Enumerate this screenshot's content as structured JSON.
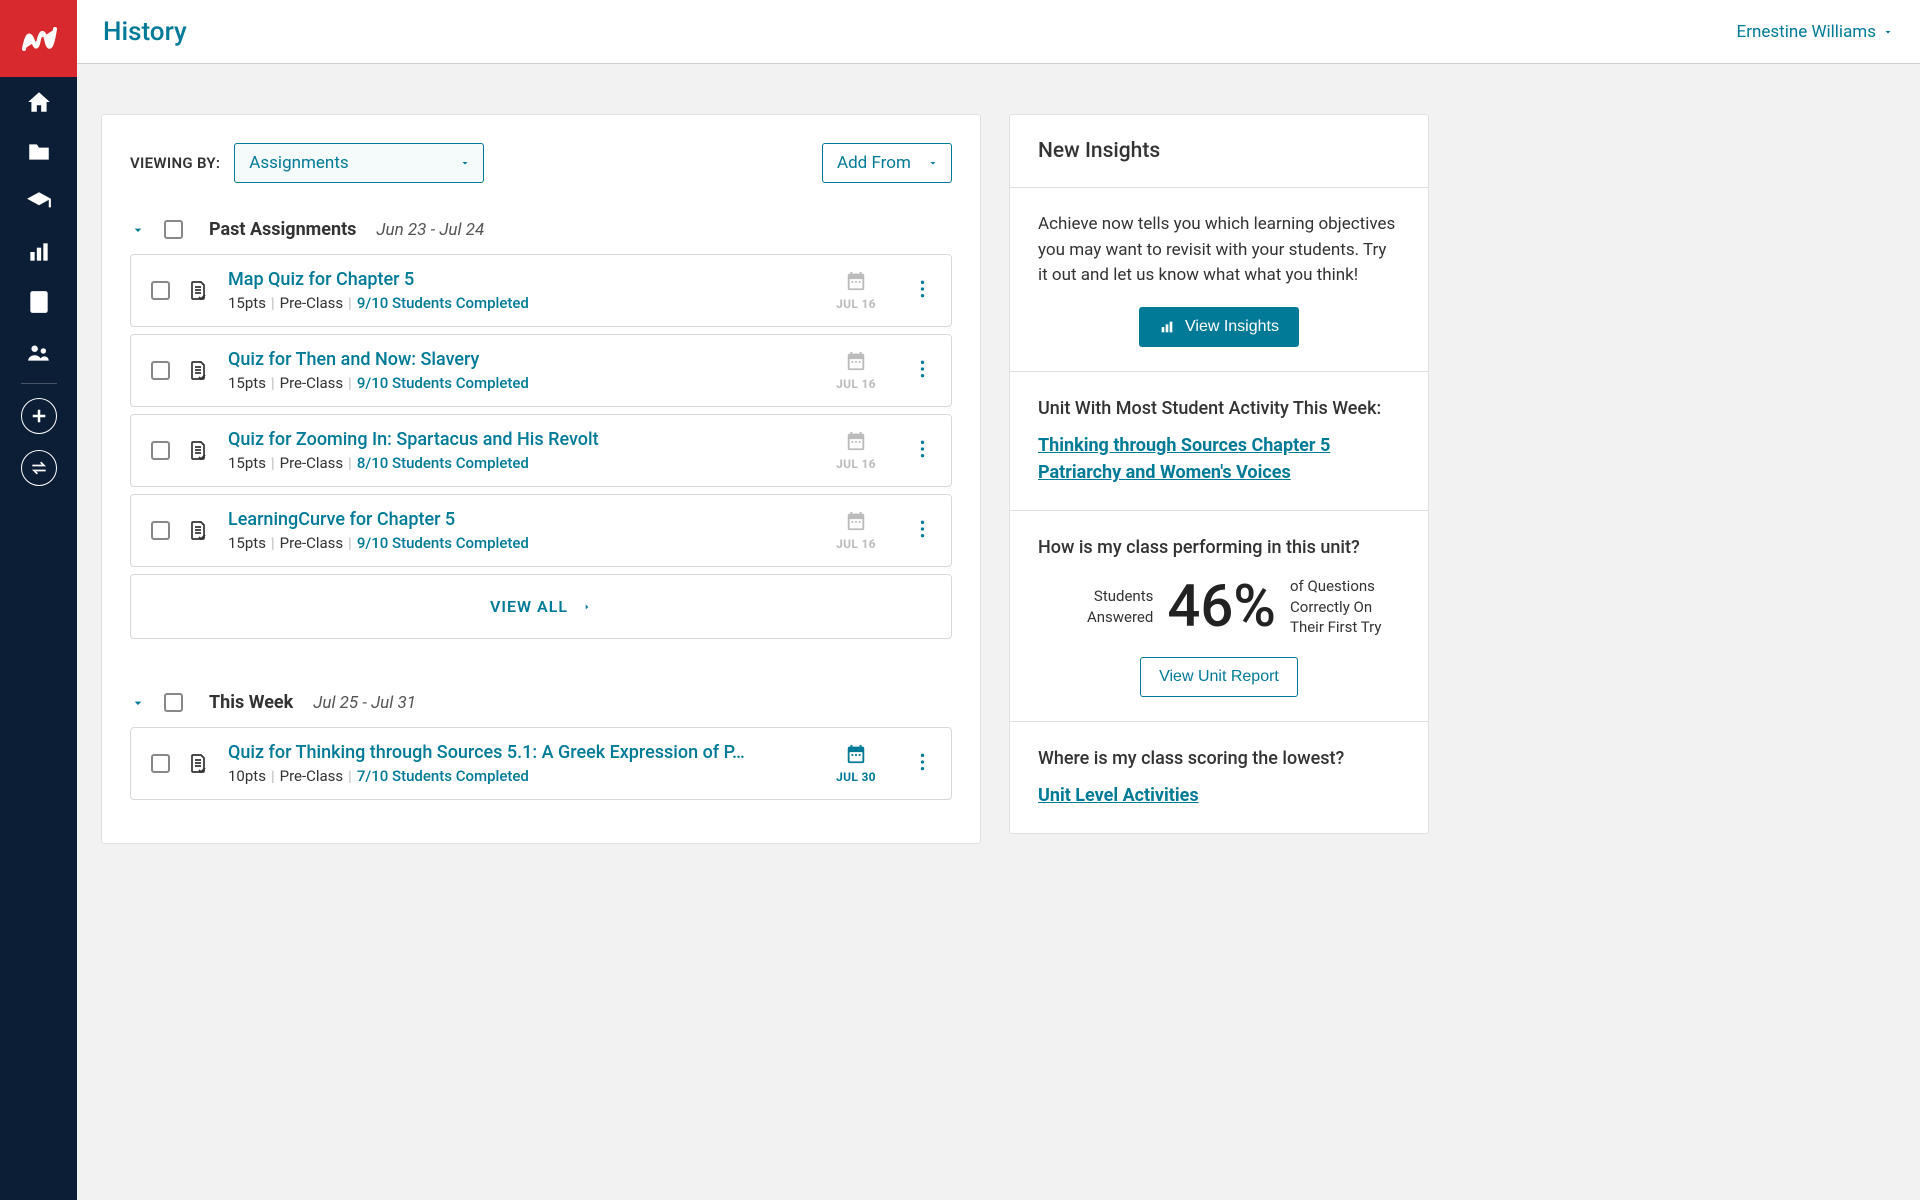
{
  "header": {
    "title": "History",
    "user": "Ernestine Williams"
  },
  "toolbar": {
    "viewing_by_label": "VIEWING BY:",
    "viewing_by_value": "Assignments",
    "add_from_label": "Add From"
  },
  "sections": {
    "past": {
      "title": "Past Assignments",
      "range": "Jun 23 - Jul 24",
      "items": [
        {
          "title": "Map Quiz for Chapter 5",
          "points": "15pts",
          "tag": "Pre-Class",
          "completed": "9/10 Students Completed",
          "due": "JUL 16",
          "accent": false
        },
        {
          "title": "Quiz for Then and Now: Slavery",
          "points": "15pts",
          "tag": "Pre-Class",
          "completed": "9/10 Students Completed",
          "due": "JUL 16",
          "accent": false
        },
        {
          "title": "Quiz for Zooming In: Spartacus and His Revolt",
          "points": "15pts",
          "tag": "Pre-Class",
          "completed": "8/10 Students Completed",
          "due": "JUL 16",
          "accent": false
        },
        {
          "title": "LearningCurve for Chapter 5",
          "points": "15pts",
          "tag": "Pre-Class",
          "completed": "9/10 Students Completed",
          "due": "JUL 16",
          "accent": false
        }
      ],
      "view_all": "VIEW ALL"
    },
    "week": {
      "title": "This Week",
      "range": "Jul 25 - Jul 31",
      "items": [
        {
          "title": "Quiz for Thinking through Sources 5.1: A Greek Expression of P…",
          "points": "10pts",
          "tag": "Pre-Class",
          "completed": "7/10 Students Completed",
          "due": "JUL 30",
          "accent": true
        }
      ]
    }
  },
  "insights": {
    "heading": "New Insights",
    "intro": "Achieve now tells you which learning objectives you may want to revisit with your students. Try it out and let us know what what you think!",
    "view_insights": "View Insights",
    "activity_title": "Unit With Most Student Activity This Week:",
    "activity_link": "Thinking through Sources Chapter 5 Patriarchy and Women's Voices",
    "perf_title": "How is my class performing in this unit?",
    "perf_left": "Students Answered",
    "perf_pct": "46%",
    "perf_right": "of Questions Correctly On Their First Try",
    "unit_report": "View Unit Report",
    "lowest_title": "Where is my class scoring the lowest?",
    "lowest_link": "Unit Level Activities"
  }
}
